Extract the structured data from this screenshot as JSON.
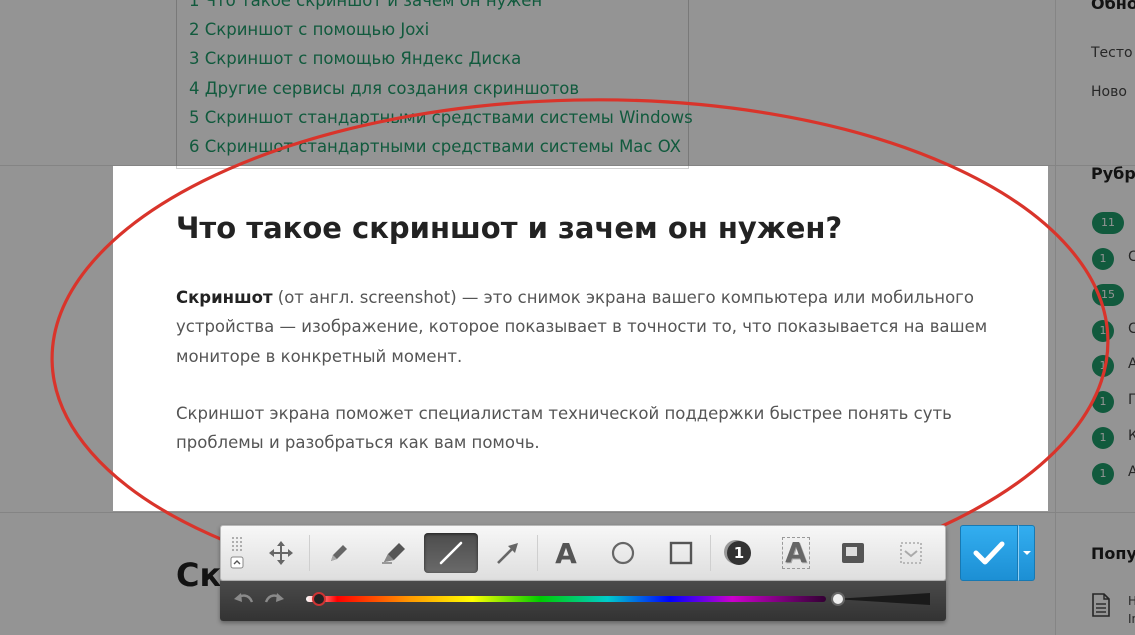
{
  "toc": {
    "items": [
      "1 Что такое скриншот и зачем он нужен",
      "2 Скриншот с помощью Joxi",
      "3 Скриншот с помощью Яндекс Диска",
      "4 Другие сервисы для создания скриншотов",
      "5 Скриншот стандартными средствами системы Windows",
      "6 Скриншот стандартными средствами системы Mac OX"
    ]
  },
  "article": {
    "title": "Что такое скриншот и зачем он нужен?",
    "para1_bold": "Скриншот",
    "para1_rest": " (от англ. screenshot) — это снимок экрана вашего компьютера или мобильного устройства — изображение, которое показывает в точности то, что показывается на вашем мониторе в конкретный момент.",
    "para2": "Скриншот экрана поможет специалистам технической поддержки быстрее понять суть проблемы и разобраться как вам помочь.",
    "next_heading": "Скр"
  },
  "sidebar": {
    "title_updates": "Обно",
    "link1": "Тесто",
    "link2": "Ново",
    "title_rubrics": "Рубр",
    "title_popular": "Попу",
    "popular_letter1": "Н",
    "popular_letter2": "In",
    "badges": [
      {
        "count": "11",
        "letter": ""
      },
      {
        "count": "1",
        "letter": "С"
      },
      {
        "count": "15",
        "letter": ""
      },
      {
        "count": "1",
        "letter": "С"
      },
      {
        "count": "1",
        "letter": "А"
      },
      {
        "count": "1",
        "letter": "П"
      },
      {
        "count": "1",
        "letter": "К"
      },
      {
        "count": "1",
        "letter": "А"
      }
    ]
  },
  "toolbar": {
    "text_tool_glyph": "A",
    "counter_glyph": "1",
    "outline_text_glyph": "A"
  },
  "colors": {
    "accent_green": "#1e9b6a",
    "annotation_red": "#d9342b",
    "confirm_blue": "#1c8fd4"
  }
}
